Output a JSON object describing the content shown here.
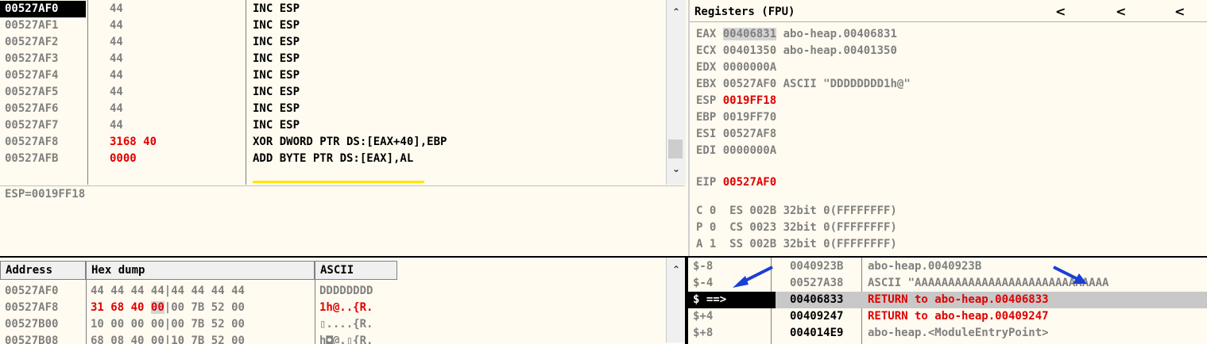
{
  "disasm": {
    "rows": [
      {
        "addr": "00527AF0",
        "hex": "44",
        "cmd": "INC ESP",
        "selected": true
      },
      {
        "addr": "00527AF1",
        "hex": "44",
        "cmd": "INC ESP"
      },
      {
        "addr": "00527AF2",
        "hex": "44",
        "cmd": "INC ESP"
      },
      {
        "addr": "00527AF3",
        "hex": "44",
        "cmd": "INC ESP"
      },
      {
        "addr": "00527AF4",
        "hex": "44",
        "cmd": "INC ESP"
      },
      {
        "addr": "00527AF5",
        "hex": "44",
        "cmd": "INC ESP"
      },
      {
        "addr": "00527AF6",
        "hex": "44",
        "cmd": "INC ESP"
      },
      {
        "addr": "00527AF7",
        "hex": "44",
        "cmd": "INC ESP"
      },
      {
        "addr": "00527AF8",
        "hex": "3168 40",
        "cmd": "XOR DWORD PTR DS:[EAX+40],EBP",
        "hexRed": true
      },
      {
        "addr": "00527AFB",
        "hex": "0000",
        "cmd": "ADD BYTE PTR DS:[EAX],AL",
        "hexRed": true
      }
    ]
  },
  "info": {
    "text": "ESP=0019FF18"
  },
  "registers": {
    "title": "Registers (FPU)",
    "rows": [
      {
        "name": "EAX",
        "value": "00406831",
        "comment": "abo-heap.00406831",
        "highlight": true
      },
      {
        "name": "ECX",
        "value": "00401350",
        "comment": "abo-heap.00401350"
      },
      {
        "name": "EDX",
        "value": "0000000A",
        "comment": ""
      },
      {
        "name": "EBX",
        "value": "00527AF0",
        "comment": "ASCII \"DDDDDDDD1h@\""
      },
      {
        "name": "ESP",
        "value": "0019FF18",
        "comment": "",
        "red": true
      },
      {
        "name": "EBP",
        "value": "0019FF70",
        "comment": ""
      },
      {
        "name": "ESI",
        "value": "00527AF8",
        "comment": ""
      },
      {
        "name": "EDI",
        "value": "0000000A",
        "comment": ""
      },
      {
        "name": "EIP",
        "value": "00527AF0",
        "comment": "",
        "red": true
      }
    ],
    "flags": [
      "C 0  ES 002B 32bit 0(FFFFFFFF)",
      "P 0  CS 0023 32bit 0(FFFFFFFF)",
      "A 1  SS 002B 32bit 0(FFFFFFFF)"
    ]
  },
  "dump": {
    "headers": {
      "address": "Address",
      "hex": "Hex dump",
      "ascii": "ASCII"
    },
    "rows": [
      {
        "addr": "00527AF0",
        "bytes": [
          "44",
          "44",
          "44",
          "44",
          "44",
          "44",
          "44",
          "44"
        ],
        "ascii": "DDDDDDDD"
      },
      {
        "addr": "00527AF8",
        "bytes": [
          "31",
          "68",
          "40",
          "00",
          "00",
          "7B",
          "52",
          "00"
        ],
        "ascii": "1h@..{R."
      },
      {
        "addr": "00527B00",
        "bytes": [
          "10",
          "00",
          "00",
          "00",
          "00",
          "7B",
          "52",
          "00"
        ],
        "ascii": "▯....{R."
      },
      {
        "addr": "00527B08",
        "bytes": [
          "68",
          "08",
          "40",
          "00",
          "10",
          "7B",
          "52",
          "00"
        ],
        "ascii": "h◘@.▯{R."
      }
    ]
  },
  "stack": {
    "rows": [
      {
        "rel": "$-8",
        "addr": "0040923B",
        "comment": "abo-heap.0040923B"
      },
      {
        "rel": "$-4",
        "addr": "00527A38",
        "comment": "ASCII \"AAAAAAAAAAAAAAAAAAAAAAAAAAAAA"
      },
      {
        "rel": "$ ==>",
        "addr": "00406833",
        "comment": "RETURN to abo-heap.00406833",
        "selected": true,
        "red": true
      },
      {
        "rel": "$+4",
        "addr": "00409247",
        "comment": "RETURN to abo-heap.00409247",
        "red": true
      },
      {
        "rel": "$+8",
        "addr": "004014E9",
        "comment": "abo-heap.<ModuleEntryPoint>"
      }
    ]
  },
  "colors": {
    "accent_red": "#e00000",
    "highlight_yellow": "#ffe600",
    "arrow_blue": "#1a3fd6",
    "background": "#fffbf0"
  },
  "icons": {
    "scroll_up": "▲",
    "arrow_left": "‹"
  }
}
